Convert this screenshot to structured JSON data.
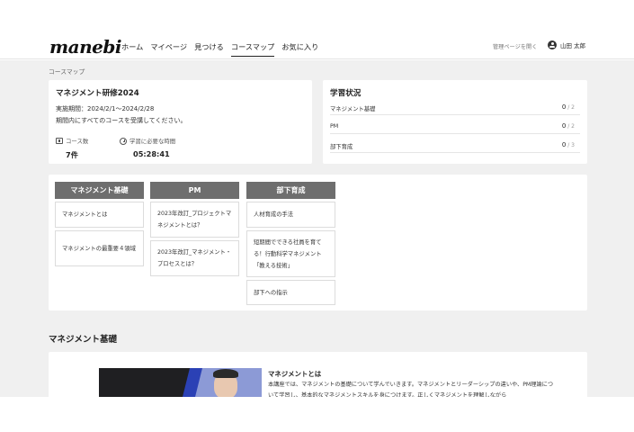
{
  "header": {
    "logo": "manebi",
    "nav": [
      "ホーム",
      "マイページ",
      "見つける",
      "コースマップ",
      "お気に入り"
    ],
    "active_nav": "コースマップ",
    "admin_link": "管理ページを開く",
    "user_name": "山田 太郎"
  },
  "breadcrumb": "コースマップ",
  "course": {
    "title": "マネジメント研修2024",
    "period": "実施期間：2024/2/1〜2024/2/28",
    "note": "期間内にすべてのコースを受講してください。",
    "count_label": "コース数",
    "count_value": "7件",
    "time_label": "学習に必要な時間",
    "time_value": "05:28:41"
  },
  "progress": {
    "title": "学習状況",
    "rows": [
      {
        "label": "マネジメント基礎",
        "done": "0",
        "total": "2"
      },
      {
        "label": "PM",
        "done": "0",
        "total": "2"
      },
      {
        "label": "部下育成",
        "done": "0",
        "total": "3"
      }
    ]
  },
  "course_map": {
    "columns": [
      {
        "name": "マネジメント基礎",
        "items": [
          "マネジメントとは",
          "マネジメントの最重要４領域"
        ]
      },
      {
        "name": "PM",
        "items": [
          "2023年改訂_プロジェクトマネジメントとは？",
          "2023年改訂_マネジメント・プロセスとは？"
        ]
      },
      {
        "name": "部下育成",
        "items": [
          "人材育成の手法",
          "短期間でできる社員を育てる！行動科学マネジメント「教える技術」",
          "部下への指示"
        ]
      }
    ]
  },
  "section": {
    "heading": "マネジメント基礎",
    "module_title": "マネジメントとは",
    "module_desc": "本講座では、マネジメントの基礎について学んでいきます。マネジメントとリーダーシップの違いや、PM理論について学習し、基本的なマネジメントスキルを身につけます。正しくマネジメントを理解しながら"
  }
}
